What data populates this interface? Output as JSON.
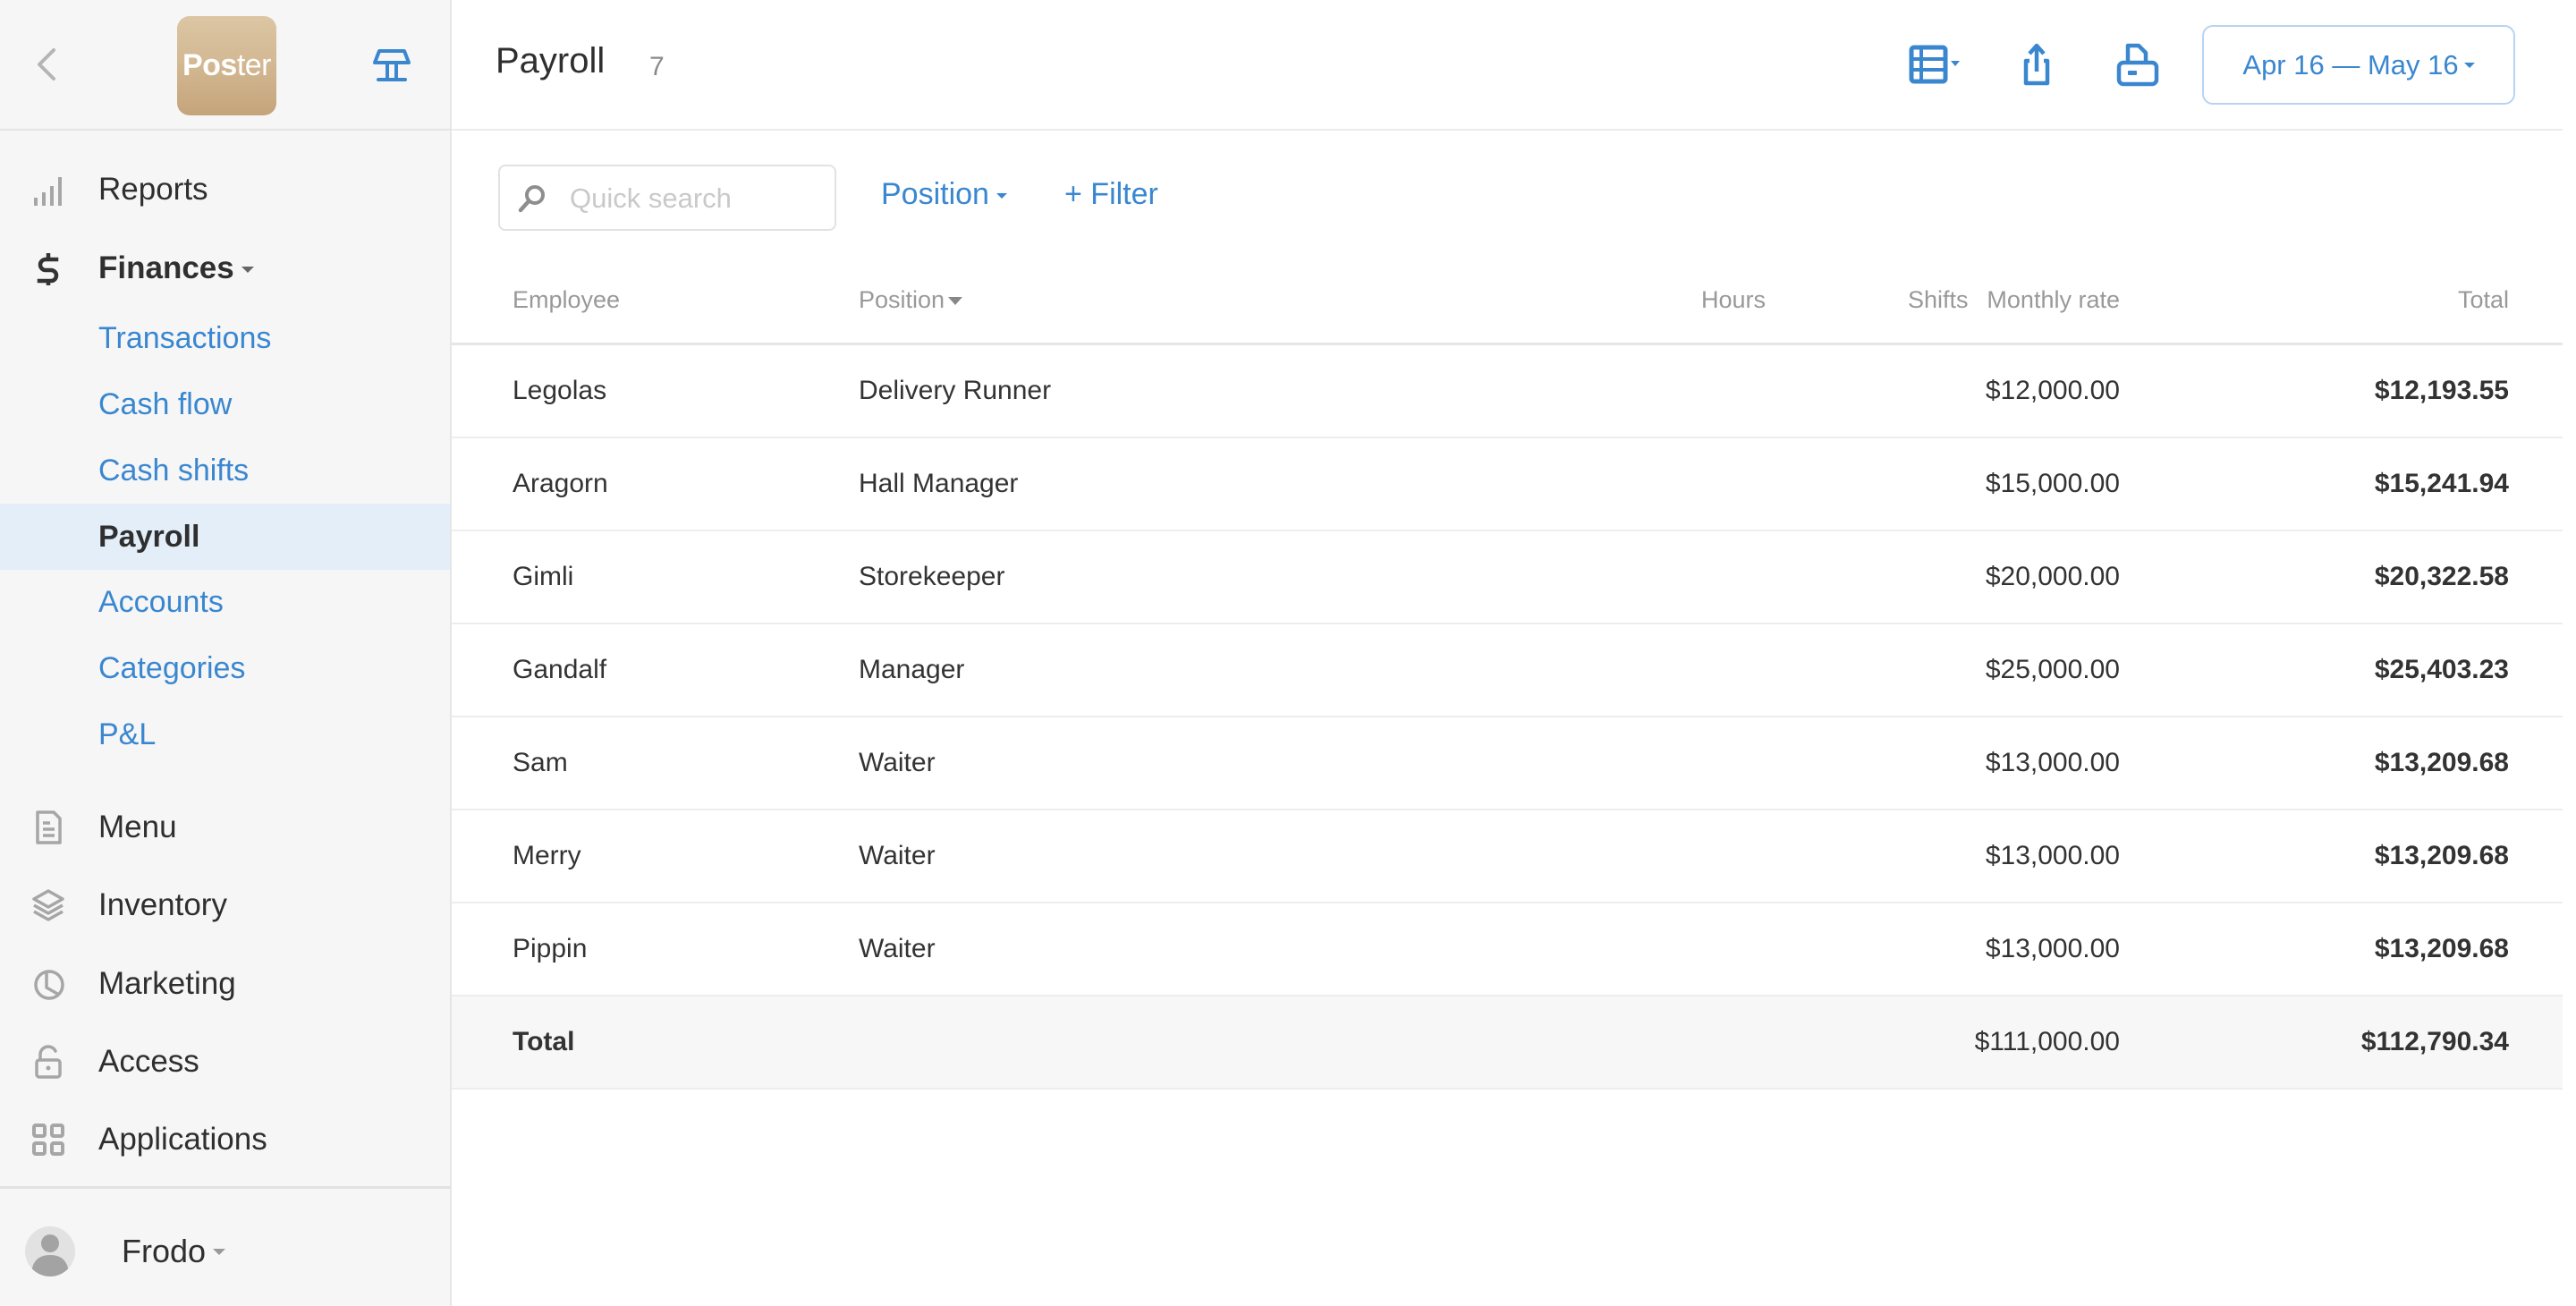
{
  "sidebar": {
    "logo": {
      "bold": "Pos",
      "thin": "ter"
    },
    "back_icon": "chevron-left-icon",
    "pos_icon": "pos-terminal-icon",
    "items": [
      {
        "label": "Reports",
        "icon": "bar-chart-icon"
      },
      {
        "label": "Finances",
        "icon": "dollar-icon",
        "expanded": true
      },
      {
        "label": "Menu",
        "icon": "document-icon"
      },
      {
        "label": "Inventory",
        "icon": "layers-icon"
      },
      {
        "label": "Marketing",
        "icon": "pie-chart-icon"
      },
      {
        "label": "Access",
        "icon": "unlock-icon"
      },
      {
        "label": "Applications",
        "icon": "grid-icon"
      }
    ],
    "finances_sub": [
      {
        "label": "Transactions"
      },
      {
        "label": "Cash flow"
      },
      {
        "label": "Cash shifts"
      },
      {
        "label": "Payroll",
        "active": true
      },
      {
        "label": "Accounts"
      },
      {
        "label": "Categories"
      },
      {
        "label": "P&L"
      }
    ],
    "user": {
      "name": "Frodo"
    }
  },
  "header": {
    "title": "Payroll",
    "count": "7",
    "date_range": "Apr 16 — May 16",
    "icons": [
      "table-columns-icon",
      "export-icon",
      "print-icon"
    ]
  },
  "filters": {
    "search_placeholder": "Quick search",
    "search_value": "",
    "position_label": "Position",
    "add_filter_label": "+ Filter"
  },
  "table": {
    "columns": [
      "Employee",
      "Position",
      "Monthly rate",
      "Hours",
      "Shifts",
      "Total"
    ],
    "rows": [
      {
        "employee": "Legolas",
        "position": "Delivery Runner",
        "rate": "$12,000.00",
        "hours": "",
        "shifts": "",
        "total": "$12,193.55"
      },
      {
        "employee": "Aragorn",
        "position": "Hall Manager",
        "rate": "$15,000.00",
        "hours": "",
        "shifts": "",
        "total": "$15,241.94"
      },
      {
        "employee": "Gimli",
        "position": "Storekeeper",
        "rate": "$20,000.00",
        "hours": "",
        "shifts": "",
        "total": "$20,322.58"
      },
      {
        "employee": "Gandalf",
        "position": "Manager",
        "rate": "$25,000.00",
        "hours": "",
        "shifts": "",
        "total": "$25,403.23"
      },
      {
        "employee": "Sam",
        "position": "Waiter",
        "rate": "$13,000.00",
        "hours": "",
        "shifts": "",
        "total": "$13,209.68"
      },
      {
        "employee": "Merry",
        "position": "Waiter",
        "rate": "$13,000.00",
        "hours": "",
        "shifts": "",
        "total": "$13,209.68"
      },
      {
        "employee": "Pippin",
        "position": "Waiter",
        "rate": "$13,000.00",
        "hours": "",
        "shifts": "",
        "total": "$13,209.68"
      }
    ],
    "total_row": {
      "label": "Total",
      "rate": "$111,000.00",
      "total": "$112,790.34"
    }
  },
  "chat": {
    "icon": "chat-bubble-icon"
  },
  "colors": {
    "accent": "#3a87d0",
    "active_bg": "#e3eef9",
    "chat": "#0c76e6",
    "sidebar_bg": "#f6f6f6"
  }
}
